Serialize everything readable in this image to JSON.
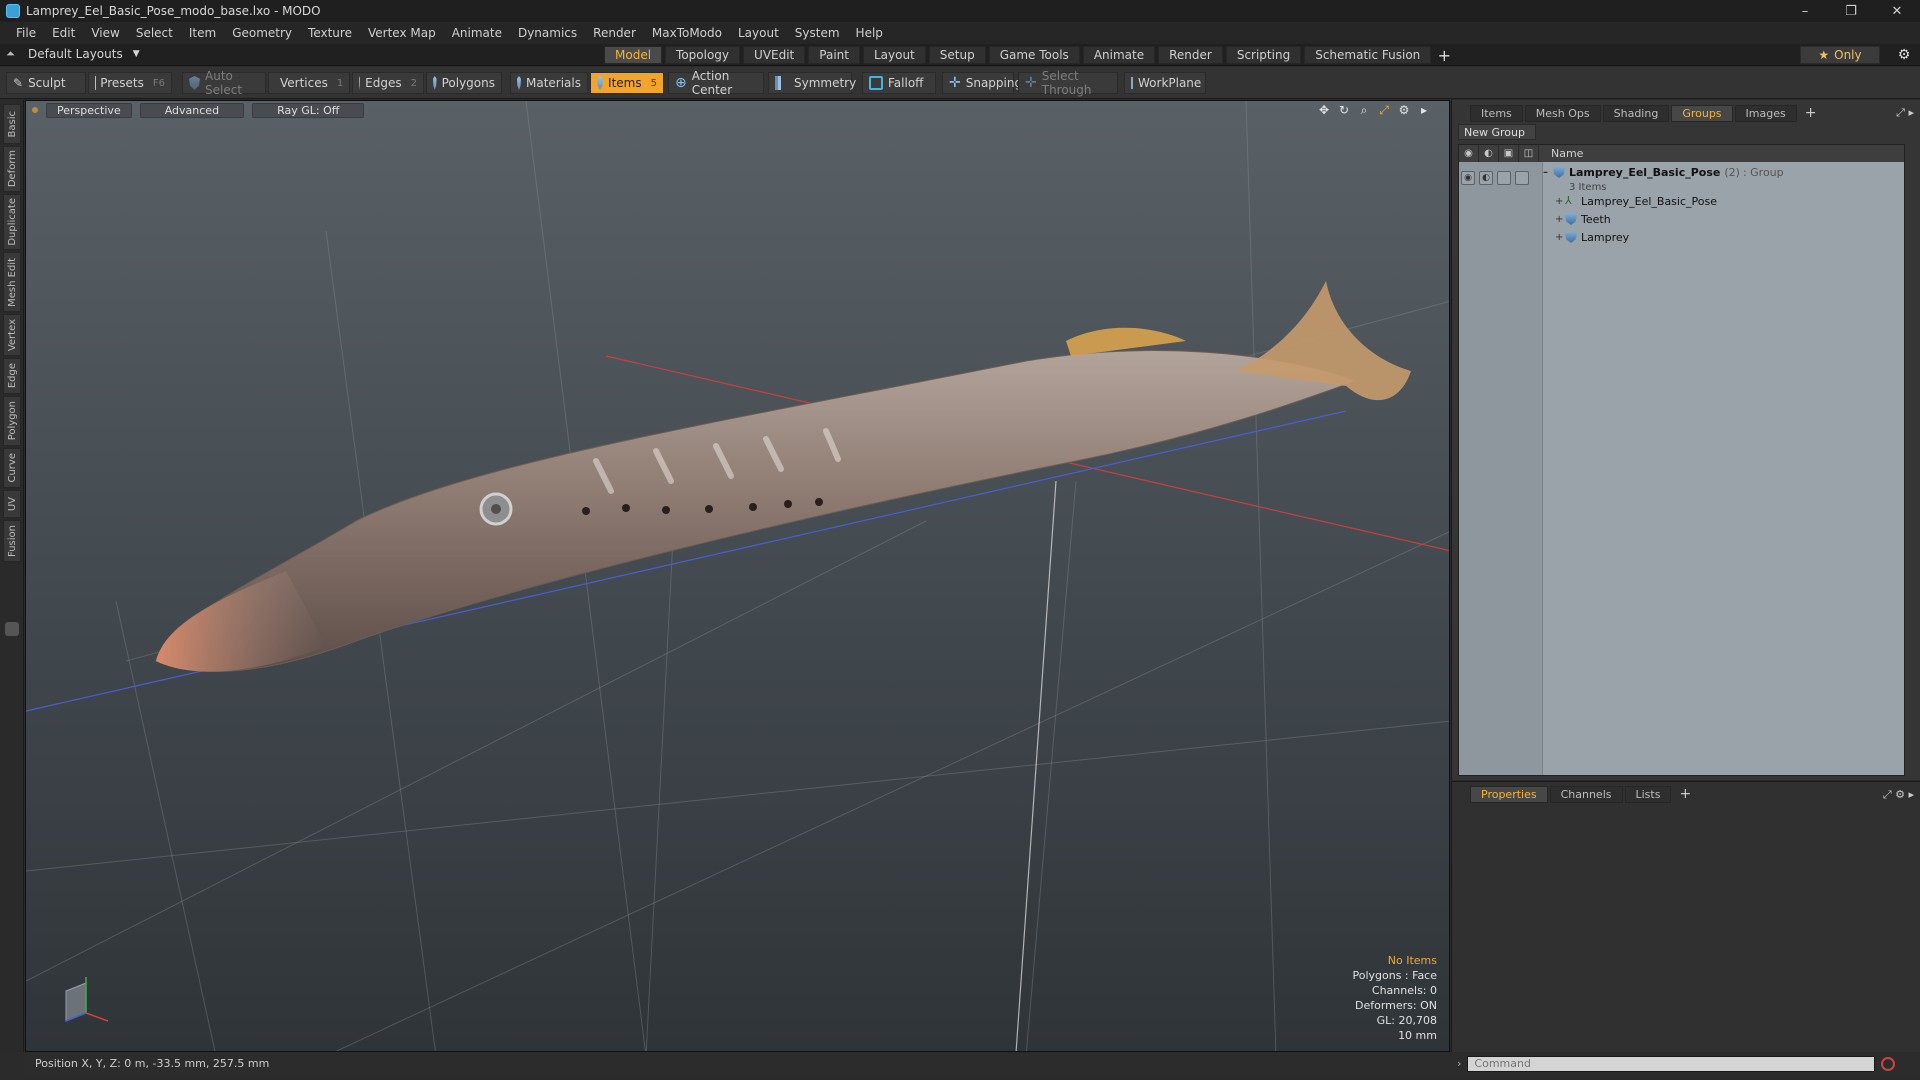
{
  "window": {
    "title": "Lamprey_Eel_Basic_Pose_modo_base.lxo - MODO",
    "controls": [
      "–",
      "❐",
      "✕"
    ]
  },
  "menu": [
    "File",
    "Edit",
    "View",
    "Select",
    "Item",
    "Geometry",
    "Texture",
    "Vertex Map",
    "Animate",
    "Dynamics",
    "Render",
    "MaxToModo",
    "Layout",
    "System",
    "Help"
  ],
  "layout_selector": "Default Layouts",
  "mode_tabs": [
    "Model",
    "Topology",
    "UVEdit",
    "Paint",
    "Layout",
    "Setup",
    "Game Tools",
    "Animate",
    "Render",
    "Scripting",
    "Schematic Fusion"
  ],
  "mode_tab_active": "Model",
  "only_label": "Only",
  "toolbar": {
    "sculpt": "Sculpt",
    "presets": "Presets",
    "presets_key": "F6",
    "auto_select": "Auto Select",
    "vertices": "Vertices",
    "vertices_key": "1",
    "edges": "Edges",
    "edges_key": "2",
    "polygons": "Polygons",
    "materials": "Materials",
    "items": "Items",
    "items_key": "5",
    "action_center": "Action Center",
    "symmetry": "Symmetry",
    "falloff": "Falloff",
    "snapping": "Snapping",
    "select_through": "Select Through",
    "workplane": "WorkPlane"
  },
  "left_tabs": [
    "Basic",
    "Deform",
    "Duplicate",
    "Mesh Edit",
    "Vertex",
    "Edge",
    "Polygon",
    "Curve",
    "UV",
    "Fusion"
  ],
  "viewport": {
    "view": "Perspective",
    "shading": "Advanced",
    "raygl": "Ray GL: Off",
    "hud": {
      "selection": "No Items",
      "polygons": "Polygons : Face",
      "channels": "Channels: 0",
      "deformers": "Deformers: ON",
      "gl": "GL: 20,708",
      "units": "10 mm"
    }
  },
  "status": "Position X, Y, Z:  0 m, -33.5 mm, 257.5 mm",
  "right_top": {
    "tabs": [
      "Items",
      "Mesh Ops",
      "Shading",
      "Groups",
      "Images"
    ],
    "active_tab": "Groups",
    "new_group": "New Group",
    "name_col": "Name",
    "root": {
      "name": "Lamprey_Eel_Basic_Pose",
      "count": "(2)",
      "type": ": Group",
      "sub": "3 Items"
    },
    "children": [
      "Lamprey_Eel_Basic_Pose",
      "Teeth",
      "Lamprey"
    ]
  },
  "right_bottom": {
    "tabs": [
      "Properties",
      "Channels",
      "Lists"
    ],
    "active_tab": "Properties"
  },
  "command_placeholder": "Command"
}
